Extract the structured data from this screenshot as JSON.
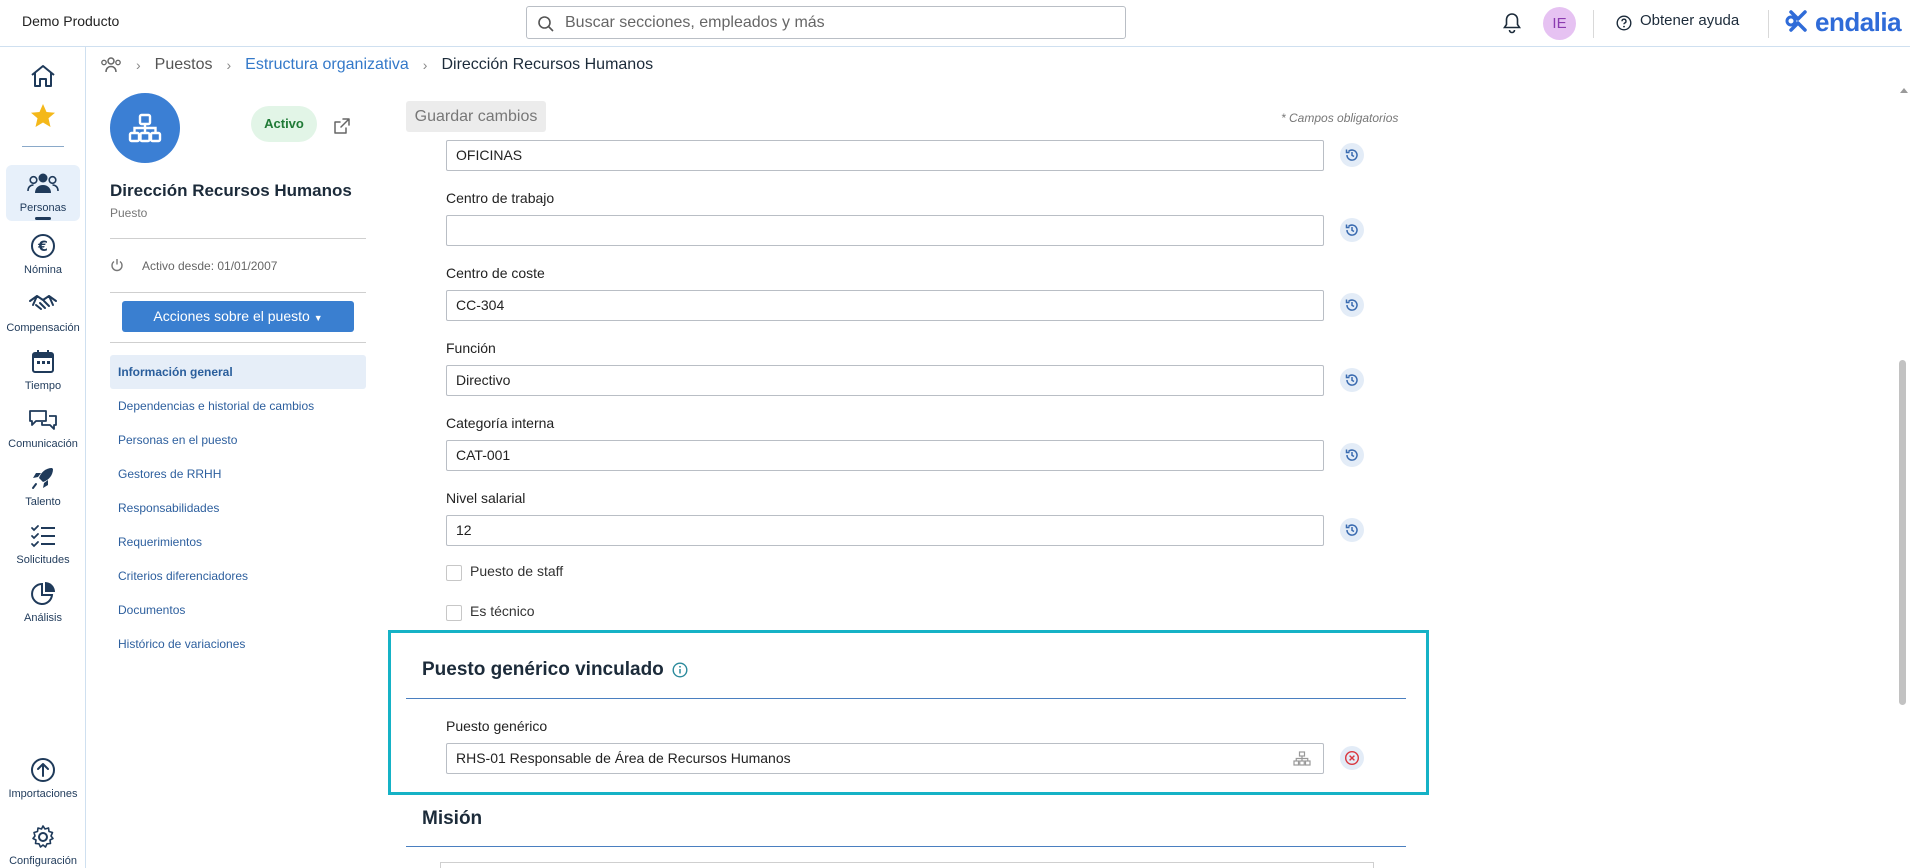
{
  "app": {
    "name": "Demo Producto"
  },
  "topbar": {
    "search_placeholder": "Buscar secciones, empleados y más",
    "avatar_initials": "IE",
    "help_label": "Obtener ayuda",
    "logo_text": "endalia"
  },
  "nav": {
    "items": [
      {
        "label": "",
        "icon": "home-icon"
      },
      {
        "label": "",
        "icon": "star-icon"
      },
      {
        "label": "Personas",
        "icon": "people-icon"
      },
      {
        "label": "Nómina",
        "icon": "euro-icon"
      },
      {
        "label": "Compensación",
        "icon": "handshake-icon"
      },
      {
        "label": "Tiempo",
        "icon": "calendar-icon"
      },
      {
        "label": "Comunicación",
        "icon": "chat-icon"
      },
      {
        "label": "Talento",
        "icon": "rocket-icon"
      },
      {
        "label": "Solicitudes",
        "icon": "checklist-icon"
      },
      {
        "label": "Análisis",
        "icon": "pie-chart-icon"
      },
      {
        "label": "Importaciones",
        "icon": "upload-icon"
      },
      {
        "label": "Configuración",
        "icon": "gear-icon"
      }
    ]
  },
  "breadcrumb": {
    "items": [
      "Puestos",
      "Estructura organizativa",
      "Dirección Recursos Humanos"
    ]
  },
  "profile": {
    "status": "Activo",
    "title": "Dirección Recursos Humanos",
    "subtitle": "Puesto",
    "active_since": "Activo desde: 01/01/2007",
    "actions_label": "Acciones sobre el puesto"
  },
  "side_menu": [
    "Información general",
    "Dependencias e historial de cambios",
    "Personas en el puesto",
    "Gestores de RRHH",
    "Responsabilidades",
    "Requerimientos",
    "Criterios diferenciadores",
    "Documentos",
    "Histórico de variaciones"
  ],
  "form": {
    "save_label": "Guardar cambios",
    "required_note": "* Campos obligatorios",
    "fields": [
      {
        "label": "",
        "value": "OFICINAS"
      },
      {
        "label": "Centro de trabajo",
        "value": ""
      },
      {
        "label": "Centro de coste",
        "value": "CC-304"
      },
      {
        "label": "Función",
        "value": "Directivo"
      },
      {
        "label": "Categoría interna",
        "value": "CAT-001"
      },
      {
        "label": "Nivel salarial",
        "value": "12"
      }
    ],
    "checkboxes": [
      {
        "label": "Puesto de staff",
        "checked": false
      },
      {
        "label": "Es técnico",
        "checked": false
      }
    ]
  },
  "generic_section": {
    "title": "Puesto genérico vinculado",
    "field_label": "Puesto genérico",
    "field_value": "RHS-01 Responsable de Área de Recursos Humanos"
  },
  "mission_section": {
    "title": "Misión"
  },
  "colors": {
    "accent": "#3a7fd0",
    "highlight": "#15b2c6",
    "brand": "#2f6bd8"
  }
}
